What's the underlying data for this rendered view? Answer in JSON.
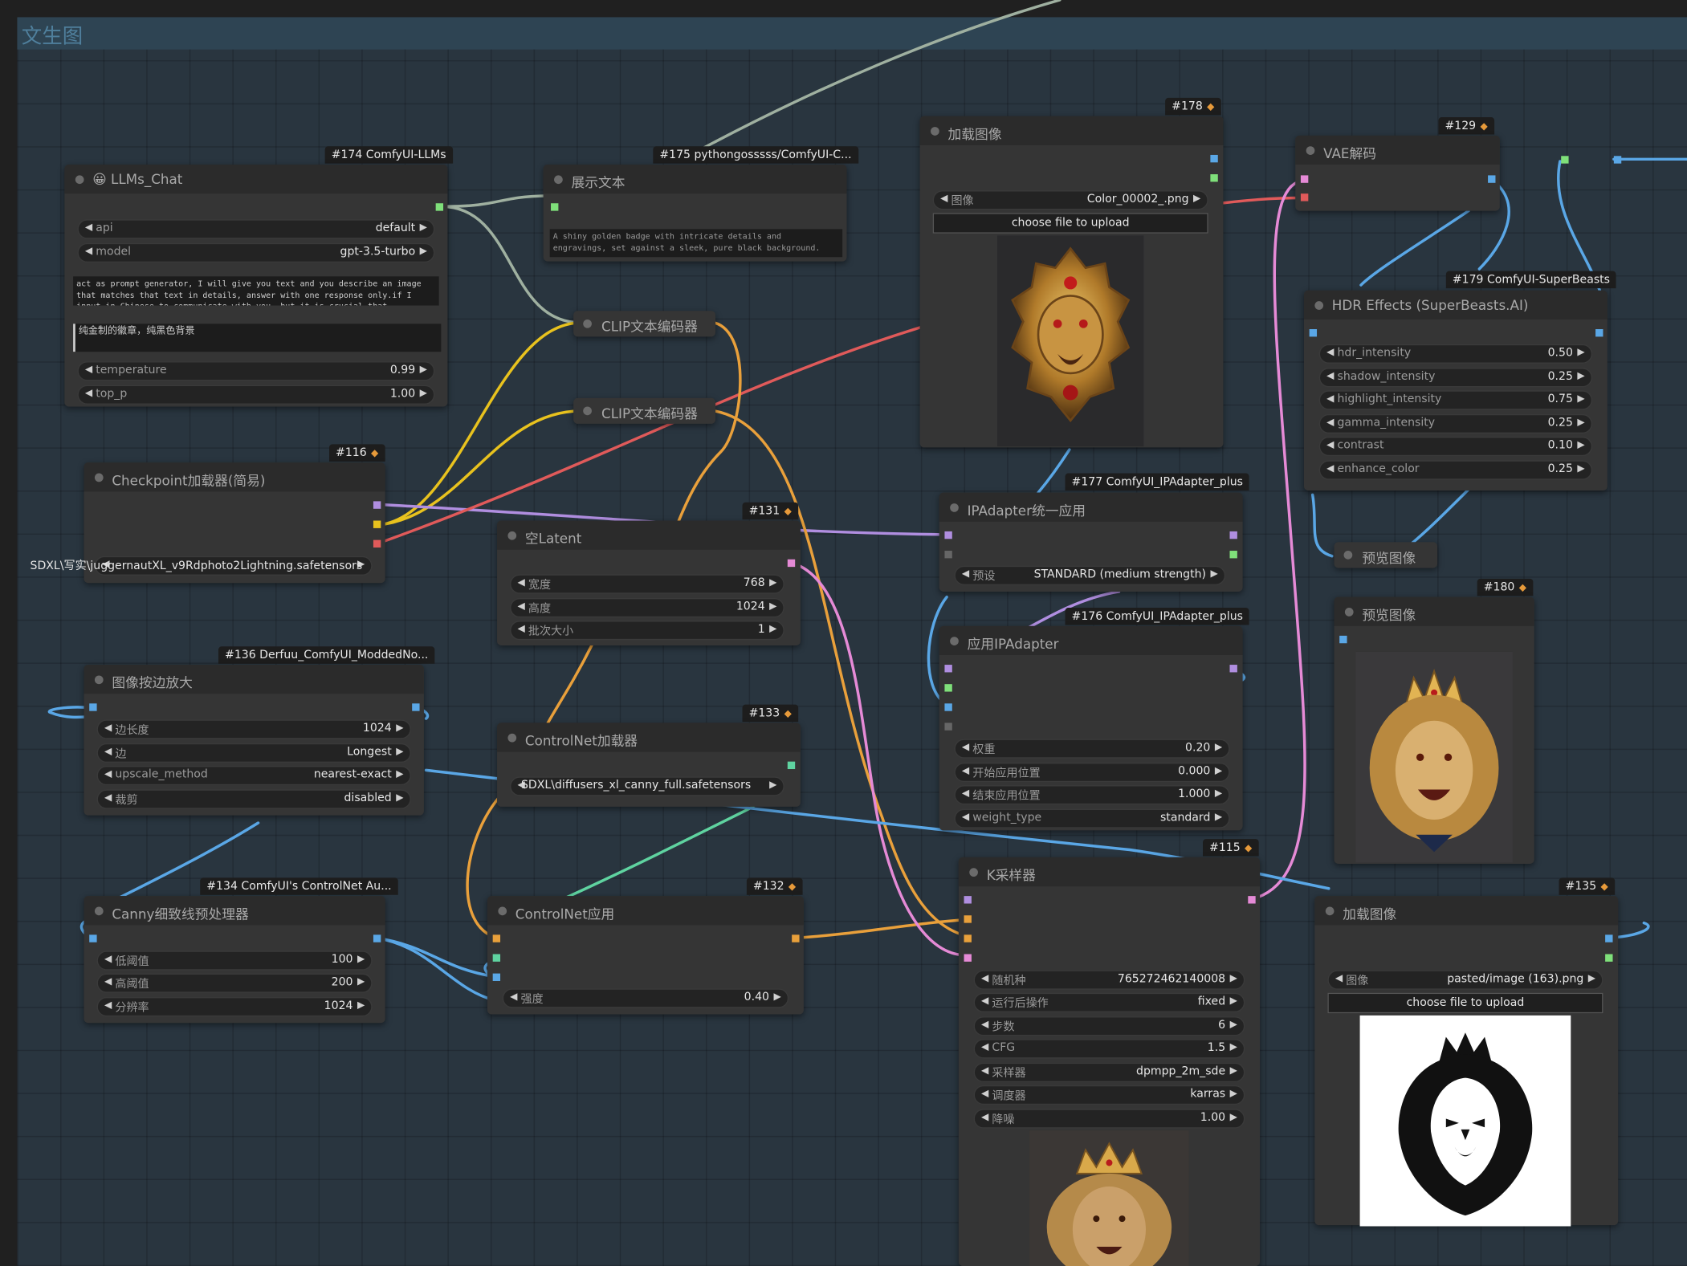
{
  "group": {
    "title": "文生图"
  },
  "nodes": {
    "llm_chat": {
      "badge": "#174 ComfyUI-LLMs",
      "title": "😀 LLMs_Chat",
      "widgets": [
        {
          "name": "api",
          "value": "default"
        },
        {
          "name": "model",
          "value": "gpt-3.5-turbo"
        }
      ],
      "system_prompt": "act as prompt generator, I will give you text and you describe an image that matches that text in details, answer with one response only.if I input in Chinese to communicate with you, but it is crucial that",
      "user_prompt": "纯金制的徽章，纯黑色背景",
      "params": [
        {
          "name": "temperature",
          "value": "0.99"
        },
        {
          "name": "top_p",
          "value": "1.00"
        }
      ]
    },
    "show_text": {
      "badge": "#175 pythongosssss/ComfyUI-C...",
      "title": "展示文本",
      "text": "A shiny golden badge with intricate details and engravings, set against a sleek, pure black background."
    },
    "clip1": {
      "title": "CLIP文本编码器"
    },
    "clip2": {
      "title": "CLIP文本编码器"
    },
    "checkpoint": {
      "badge": "#116",
      "title": "Checkpoint加载器(简易)",
      "ckpt_overlap": "SDXL\\写实\\juggernautXL_v9Rdphoto2Lightning.safetensors"
    },
    "empty_latent": {
      "badge": "#131",
      "title": "空Latent",
      "widgets": [
        {
          "name": "宽度",
          "value": "768"
        },
        {
          "name": "高度",
          "value": "1024"
        },
        {
          "name": "批次大小",
          "value": "1"
        }
      ]
    },
    "upscale": {
      "badge": "#136 Derfuu_ComfyUI_ModdedNo...",
      "title": "图像按边放大",
      "widgets": [
        {
          "name": "边长度",
          "value": "1024"
        },
        {
          "name": "边",
          "value": "Longest"
        },
        {
          "name": "upscale_method",
          "value": "nearest-exact"
        },
        {
          "name": "裁剪",
          "value": "disabled"
        }
      ]
    },
    "controlnet_loader": {
      "badge": "#133",
      "title": "ControlNet加载器",
      "value_overlap": "SDXL\\diffusers_xl_canny_full.safetensors"
    },
    "canny": {
      "badge": "#134 ComfyUI's ControlNet Au...",
      "title": "Canny细致线预处理器",
      "widgets": [
        {
          "name": "低阈值",
          "value": "100"
        },
        {
          "name": "高阈值",
          "value": "200"
        },
        {
          "name": "分辨率",
          "value": "1024"
        }
      ]
    },
    "controlnet_apply": {
      "badge": "#132",
      "title": "ControlNet应用",
      "widgets": [
        {
          "name": "强度",
          "value": "0.40"
        }
      ]
    },
    "load_image1": {
      "badge": "#178",
      "title": "加载图像",
      "widgets": [
        {
          "name": "图像",
          "value": "Color_00002_.png"
        }
      ],
      "button": "choose file to upload"
    },
    "ipadapter_unified": {
      "badge": "#177 ComfyUI_IPAdapter_plus",
      "title": "IPAdapter统一应用",
      "widgets": [
        {
          "name": "预设",
          "value": "STANDARD (medium strength)"
        }
      ]
    },
    "ipadapter_apply": {
      "badge": "#176 ComfyUI_IPAdapter_plus",
      "title": "应用IPAdapter",
      "widgets": [
        {
          "name": "权重",
          "value": "0.20"
        },
        {
          "name": "开始应用位置",
          "value": "0.000"
        },
        {
          "name": "结束应用位置",
          "value": "1.000"
        },
        {
          "name": "weight_type",
          "value": "standard"
        }
      ]
    },
    "ksampler": {
      "badge": "#115",
      "title": "K采样器",
      "widgets": [
        {
          "name": "随机种",
          "value": "765272462140008"
        },
        {
          "name": "运行后操作",
          "value": "fixed"
        },
        {
          "name": "步数",
          "value": "6"
        },
        {
          "name": "CFG",
          "value": "1.5"
        },
        {
          "name": "采样器",
          "value": "dpmpp_2m_sde"
        },
        {
          "name": "调度器",
          "value": "karras"
        },
        {
          "name": "降噪",
          "value": "1.00"
        }
      ]
    },
    "vae_decode": {
      "badge": "#129",
      "title": "VAE解码"
    },
    "hdr": {
      "badge": "#179 ComfyUI-SuperBeasts",
      "title": "HDR Effects (SuperBeasts.AI)",
      "widgets": [
        {
          "name": "hdr_intensity",
          "value": "0.50"
        },
        {
          "name": "shadow_intensity",
          "value": "0.25"
        },
        {
          "name": "highlight_intensity",
          "value": "0.75"
        },
        {
          "name": "gamma_intensity",
          "value": "0.25"
        },
        {
          "name": "contrast",
          "value": "0.10"
        },
        {
          "name": "enhance_color",
          "value": "0.25"
        }
      ]
    },
    "preview_collapsed": {
      "title": "预览图像"
    },
    "preview": {
      "badge": "#180",
      "title": "预览图像"
    },
    "load_image2": {
      "badge": "#135",
      "title": "加载图像",
      "widgets": [
        {
          "name": "图像",
          "value": "pasted/image (163).png"
        }
      ],
      "button": "choose file to upload"
    }
  },
  "colors": {
    "clip_yellow": "#e8c21e",
    "model_lavender": "#b08ee0",
    "vae_red": "#e05a5a",
    "image_blue": "#5aa7e6",
    "latent_pink": "#e58ad6",
    "conditioning_orange": "#e9a03b",
    "controlnet_green": "#5fd3a0",
    "string_grey": "#9fb0a0"
  }
}
